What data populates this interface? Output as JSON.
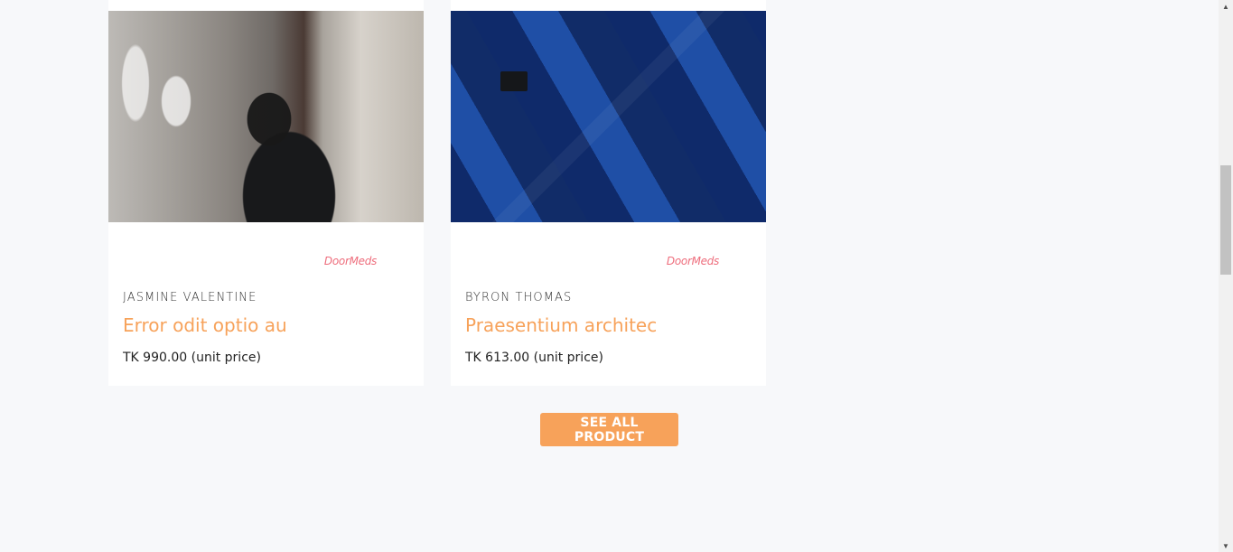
{
  "products": [
    {
      "brand": "DoorMeds",
      "author": "JASMINE VALENTINE",
      "title": "Error odit optio au",
      "price": "TK 990.00 (unit price)"
    },
    {
      "brand": "DoorMeds",
      "author": "BYRON THOMAS",
      "title": "Praesentium architec",
      "price": "TK 613.00 (unit price)"
    }
  ],
  "cta": {
    "see_all_label": "SEE ALL PRODUCT"
  },
  "scrollbar": {
    "up_icon": "▲",
    "down_icon": "▼"
  },
  "colors": {
    "accent": "#f7a25a",
    "brand_text": "#ee6d7c",
    "background": "#f7f8fa"
  }
}
